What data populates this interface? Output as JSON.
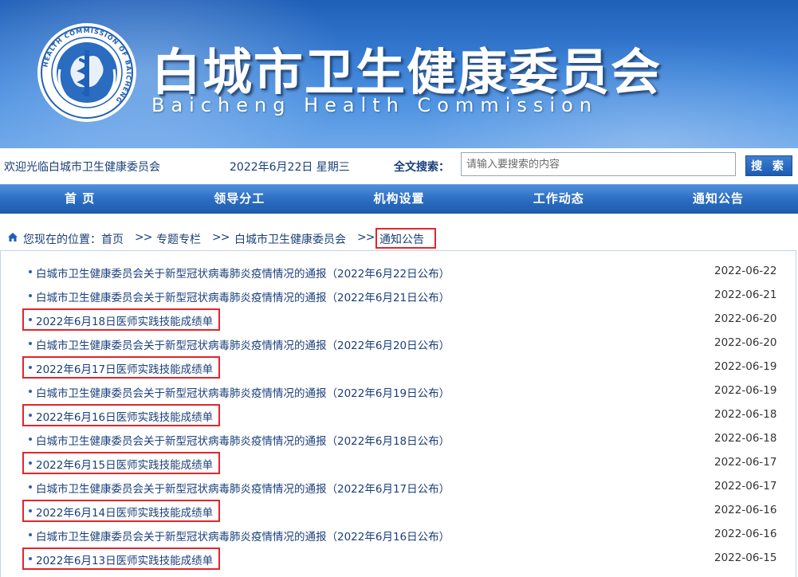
{
  "header": {
    "title": "白城市卫生健康委员会",
    "subtitle": "Baicheng Health Commission",
    "emblem_text": "HEALTH COMMISSION OF BAICHENG"
  },
  "topbar": {
    "welcome": "欢迎光临白城市卫生健康委员会",
    "date": "2022年6月22日 星期三",
    "search_label": "全文搜索：",
    "search_placeholder": "请输入要搜索的内容",
    "search_button": "搜 索"
  },
  "nav": {
    "items": [
      {
        "label": "首 页"
      },
      {
        "label": "领导分工"
      },
      {
        "label": "机构设置"
      },
      {
        "label": "工作动态"
      },
      {
        "label": "通知公告"
      }
    ]
  },
  "breadcrumb": {
    "prefix": "您现在的位置：",
    "separator": ">>",
    "items": [
      "首页",
      "专题专栏",
      "白城市卫生健康委员会",
      "通知公告"
    ],
    "highlighted_index": 3
  },
  "list": {
    "items": [
      {
        "title": "白城市卫生健康委员会关于新型冠状病毒肺炎疫情情况的通报（2022年6月22日公布）",
        "date": "2022-06-22",
        "highlighted": false
      },
      {
        "title": "白城市卫生健康委员会关于新型冠状病毒肺炎疫情情况的通报（2022年6月21日公布）",
        "date": "2022-06-21",
        "highlighted": false
      },
      {
        "title": "2022年6月18日医师实践技能成绩单",
        "date": "2022-06-20",
        "highlighted": true
      },
      {
        "title": "白城市卫生健康委员会关于新型冠状病毒肺炎疫情情况的通报（2022年6月20日公布）",
        "date": "2022-06-20",
        "highlighted": false
      },
      {
        "title": "2022年6月17日医师实践技能成绩单",
        "date": "2022-06-19",
        "highlighted": true
      },
      {
        "title": "白城市卫生健康委员会关于新型冠状病毒肺炎疫情情况的通报（2022年6月19日公布）",
        "date": "2022-06-19",
        "highlighted": false
      },
      {
        "title": "2022年6月16日医师实践技能成绩单",
        "date": "2022-06-18",
        "highlighted": true
      },
      {
        "title": "白城市卫生健康委员会关于新型冠状病毒肺炎疫情情况的通报（2022年6月18日公布）",
        "date": "2022-06-18",
        "highlighted": false
      },
      {
        "title": "2022年6月15日医师实践技能成绩单",
        "date": "2022-06-17",
        "highlighted": true
      },
      {
        "title": "白城市卫生健康委员会关于新型冠状病毒肺炎疫情情况的通报（2022年6月17日公布）",
        "date": "2022-06-17",
        "highlighted": false
      },
      {
        "title": "2022年6月14日医师实践技能成绩单",
        "date": "2022-06-16",
        "highlighted": true
      },
      {
        "title": "白城市卫生健康委员会关于新型冠状病毒肺炎疫情情况的通报（2022年6月16日公布）",
        "date": "2022-06-16",
        "highlighted": false
      },
      {
        "title": "2022年6月13日医师实践技能成绩单",
        "date": "2022-06-15",
        "highlighted": true
      }
    ]
  },
  "colors": {
    "banner": "#3a80d6",
    "nav": "#2d6fc4",
    "link": "#1a3f7a",
    "highlight": "#e1262c"
  }
}
